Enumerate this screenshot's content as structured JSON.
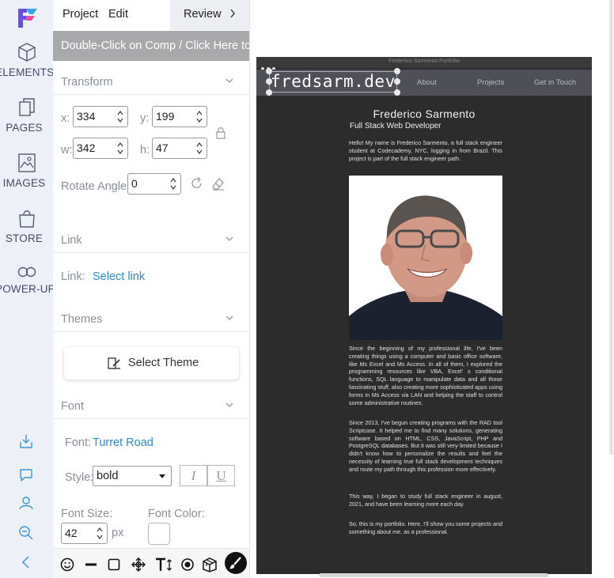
{
  "rail": {
    "items": [
      {
        "label": "ELEMENTS",
        "icon": "cube-icon"
      },
      {
        "label": "PAGES",
        "icon": "pages-icon"
      },
      {
        "label": "IMAGES",
        "icon": "image-icon"
      },
      {
        "label": "STORE",
        "icon": "store-bag-icon"
      },
      {
        "label": "POWER-UP",
        "icon": "infinity-icon"
      }
    ],
    "bottom_icons": [
      "download-icon",
      "chat-icon",
      "users-icon",
      "zoom-out-icon",
      "collapse-icon"
    ]
  },
  "menu": {
    "project": "Project",
    "edit": "Edit",
    "review": "Review"
  },
  "banner": "Double-Click on Comp / Click Here to",
  "transform": {
    "title": "Transform",
    "x_label": "x:",
    "x_value": "334",
    "y_label": "y:",
    "y_value": "199",
    "w_label": "w:",
    "w_value": "342",
    "h_label": "h:",
    "h_value": "47",
    "rotate_label": "Rotate Angle:",
    "rotate_value": "0"
  },
  "link": {
    "title": "Link",
    "label": "Link:",
    "select": "Select link"
  },
  "themes": {
    "title": "Themes",
    "button": "Select Theme"
  },
  "font": {
    "title": "Font",
    "font_label": "Font:",
    "font_value": "Turret Road",
    "style_label": "Style:",
    "style_value": "bold",
    "italic": "I",
    "underline": "U",
    "size_label": "Font Size:",
    "size_value": "42",
    "size_unit": "px",
    "color_label": "Font Color:"
  },
  "preview": {
    "window_title": "Frederico Sarmento Portfolio",
    "logo": "fredsarm.dev",
    "nav": [
      "About",
      "Projects",
      "Get in Touch"
    ],
    "name": "Frederico Sarmento",
    "role": "Full Stack Web Developer",
    "intro": "Hello! My name is Frederico Sarmento, a full stack engineer student at Codecademy, NYC, logging in from Brazil. This project is part of the full stack engineer path.",
    "paragraphs": [
      "Since the beginning of my professional life, I've been creating things using a computer and basic office software, like Ms Excel and Ms Access. In all of them, I explored the programming resources like VBA, Excel' s conditional functions, SQL language to manipulate data and all those fascinating stuff, also creating more sophisticated apps using forms in Ms Access via LAN and helping the staff to control some administrative routines.",
      "Since 2013, I've begun creating programs with the RAD tool Scriptcase. It helped me to find many solutions, generating software based on HTML, CSS, JavaScript, PHP and PostgreSQL databases. But it was still very limited because I didn't know how to personalize the results and feel the necessity of learning true full stack development techniques and route my path through this profession more effectively.",
      "This way, I began to study full stack engineer in august, 2021, and have been learning more each day.",
      "So, this is my portfolio. Here, I'll show you some projects and something about me, as a professional."
    ]
  },
  "colors": {
    "accent": "#2a8bd0",
    "banner": "#a9a9ab",
    "preview_bg": "#2c2c2c",
    "nav_bg": "#4f4f58"
  }
}
